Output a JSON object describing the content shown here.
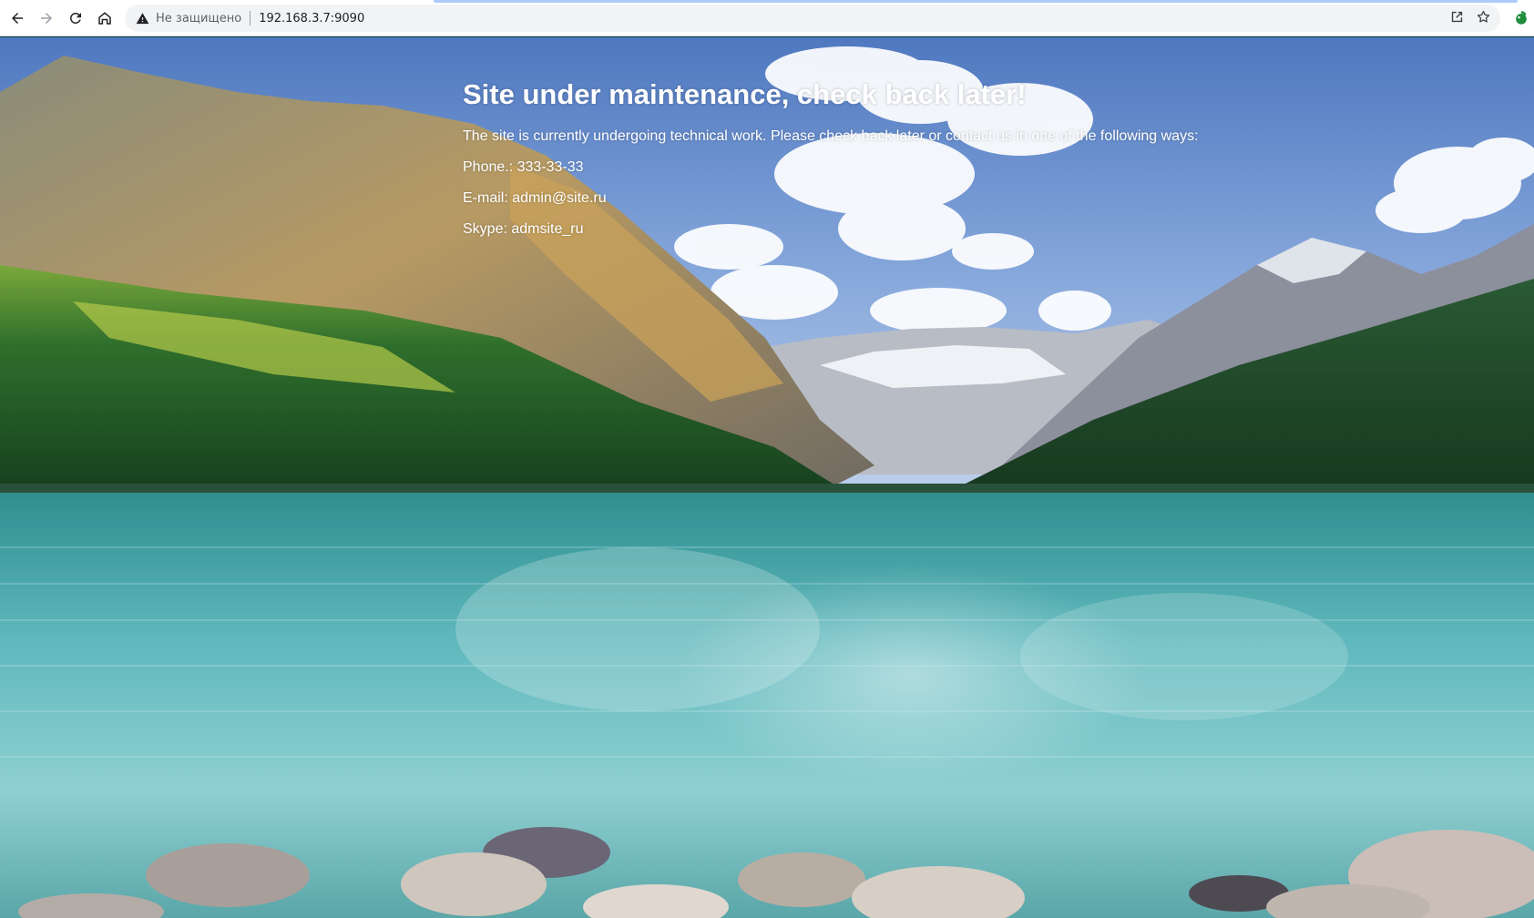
{
  "browser": {
    "security_label": "Не защищено",
    "url": "192.168.3.7:9090",
    "icons": [
      "back-icon",
      "forward-icon",
      "reload-icon",
      "home-icon",
      "warning-icon",
      "share-icon",
      "star-icon",
      "extension-icon"
    ]
  },
  "page": {
    "title": "Site under maintenance, check back later!",
    "intro": "The site is currently undergoing technical work. Please check back later or contact us in one of the following ways:",
    "contacts": [
      {
        "label": "Phone.:",
        "value": "333-33-33"
      },
      {
        "label": "E-mail:",
        "value": "admin@site.ru"
      },
      {
        "label": "Skype:",
        "value": "admsite_ru"
      }
    ]
  },
  "colors": {
    "sky": "#7fa6d8",
    "water": "#5fb8bd",
    "forest": "#1f5a2a",
    "text": "#ffffff"
  }
}
